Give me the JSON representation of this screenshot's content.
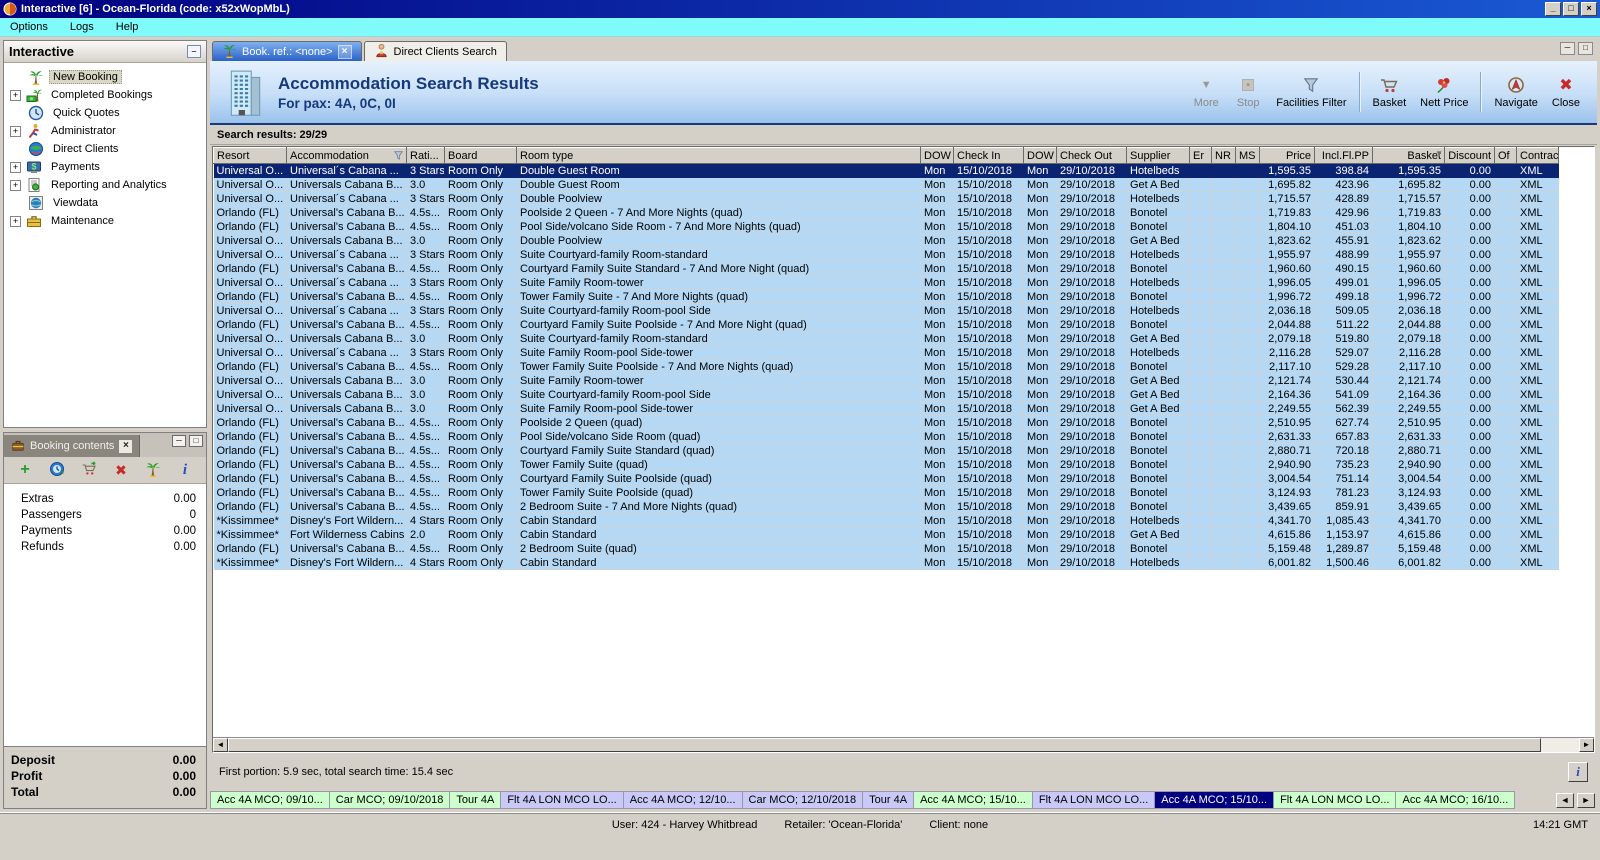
{
  "window": {
    "title": "Interactive [6] - Ocean-Florida (code: x52xWopMbL)",
    "controls": [
      "minimize",
      "maximize",
      "close"
    ]
  },
  "menu": {
    "items": [
      "Options",
      "Logs",
      "Help"
    ]
  },
  "sidebar": {
    "title": "Interactive",
    "items": [
      {
        "label": "New Booking",
        "icon": "palm-tree-icon",
        "expandable": false,
        "selected": true
      },
      {
        "label": "Completed Bookings",
        "icon": "money-palm-icon",
        "expandable": true,
        "selected": false
      },
      {
        "label": "Quick Quotes",
        "icon": "clock-icon",
        "expandable": false,
        "selected": false
      },
      {
        "label": "Administrator",
        "icon": "runner-icon",
        "expandable": true,
        "selected": false
      },
      {
        "label": "Direct Clients",
        "icon": "globe-icon",
        "expandable": false,
        "selected": false
      },
      {
        "label": "Payments",
        "icon": "payments-icon",
        "expandable": true,
        "selected": false
      },
      {
        "label": "Reporting and Analytics",
        "icon": "report-icon",
        "expandable": true,
        "selected": false
      },
      {
        "label": "Viewdata",
        "icon": "viewdata-icon",
        "expandable": false,
        "selected": false
      },
      {
        "label": "Maintenance",
        "icon": "toolbox-icon",
        "expandable": true,
        "selected": false
      }
    ]
  },
  "tabs": [
    {
      "label": "Book. ref.: <none>",
      "icon": "palm-tree-icon",
      "active": true,
      "closable": true
    },
    {
      "label": "Direct Clients Search",
      "icon": "person-icon",
      "active": false,
      "closable": false
    }
  ],
  "header": {
    "title": "Accommodation Search Results",
    "subtitle": "For pax: 4A, 0C, 0I",
    "icon": "building-icon"
  },
  "toolbar": {
    "buttons": [
      {
        "label": "More",
        "icon": "down-arrow-icon",
        "disabled": true,
        "sep_before": false
      },
      {
        "label": "Stop",
        "icon": "stop-icon",
        "disabled": true,
        "sep_before": false
      },
      {
        "label": "Facilities Filter",
        "icon": "funnel-icon",
        "disabled": false,
        "sep_before": false
      },
      {
        "label": "Basket",
        "icon": "basket-icon",
        "disabled": false,
        "sep_before": true
      },
      {
        "label": "Nett Price",
        "icon": "nett-price-icon",
        "disabled": false,
        "sep_before": false
      },
      {
        "label": "Navigate",
        "icon": "compass-icon",
        "disabled": false,
        "sep_before": true
      },
      {
        "label": "Close",
        "icon": "close-icon",
        "disabled": false,
        "sep_before": false
      }
    ]
  },
  "results": {
    "summary": "Search results: 29/29",
    "status": "First portion: 5.9 sec, total search time: 15.4 sec",
    "selected_row_index": 0,
    "columns": [
      {
        "label": "Resort",
        "align": "left",
        "filter_icon": false,
        "sort_icon": false
      },
      {
        "label": "Accommodation",
        "align": "left",
        "filter_icon": true,
        "sort_icon": false
      },
      {
        "label": "Rati...",
        "align": "left",
        "filter_icon": false,
        "sort_icon": false
      },
      {
        "label": "Board",
        "align": "left",
        "filter_icon": false,
        "sort_icon": false
      },
      {
        "label": "Room type",
        "align": "left",
        "filter_icon": false,
        "sort_icon": false
      },
      {
        "label": "DOW",
        "align": "left",
        "filter_icon": false,
        "sort_icon": false
      },
      {
        "label": "Check In",
        "align": "left",
        "filter_icon": false,
        "sort_icon": false
      },
      {
        "label": "DOW",
        "align": "left",
        "filter_icon": false,
        "sort_icon": false
      },
      {
        "label": "Check Out",
        "align": "left",
        "filter_icon": false,
        "sort_icon": false
      },
      {
        "label": "Supplier",
        "align": "left",
        "filter_icon": false,
        "sort_icon": false
      },
      {
        "label": "Er",
        "align": "left",
        "filter_icon": false,
        "sort_icon": false
      },
      {
        "label": "NR",
        "align": "left",
        "filter_icon": false,
        "sort_icon": false
      },
      {
        "label": "MS",
        "align": "left",
        "filter_icon": false,
        "sort_icon": false
      },
      {
        "label": "Price",
        "align": "right",
        "filter_icon": false,
        "sort_icon": false
      },
      {
        "label": "Incl.Fl.PP",
        "align": "right",
        "filter_icon": false,
        "sort_icon": false
      },
      {
        "label": "Basket",
        "align": "right",
        "filter_icon": false,
        "sort_icon": true
      },
      {
        "label": "Discount",
        "align": "right",
        "filter_icon": false,
        "sort_icon": false
      },
      {
        "label": "Of",
        "align": "left",
        "filter_icon": false,
        "sort_icon": false
      },
      {
        "label": "Contract",
        "align": "left",
        "filter_icon": false,
        "sort_icon": false
      }
    ],
    "rows": [
      [
        "Universal O...",
        "Universal´s Cabana ...",
        "3 Stars",
        "Room Only",
        "Double Guest Room",
        "Mon",
        "15/10/2018",
        "Mon",
        "29/10/2018",
        "Hotelbeds",
        "",
        "",
        "",
        "1,595.35",
        "398.84",
        "1,595.35",
        "0.00",
        "",
        "XML"
      ],
      [
        "Universal O...",
        "Universals Cabana B...",
        "3.0",
        "Room Only",
        "Double Guest Room",
        "Mon",
        "15/10/2018",
        "Mon",
        "29/10/2018",
        "Get A Bed",
        "",
        "",
        "",
        "1,695.82",
        "423.96",
        "1,695.82",
        "0.00",
        "",
        "XML"
      ],
      [
        "Universal O...",
        "Universal´s Cabana ...",
        "3 Stars",
        "Room Only",
        "Double Poolview",
        "Mon",
        "15/10/2018",
        "Mon",
        "29/10/2018",
        "Hotelbeds",
        "",
        "",
        "",
        "1,715.57",
        "428.89",
        "1,715.57",
        "0.00",
        "",
        "XML"
      ],
      [
        "Orlando (FL)",
        "Universal's Cabana B...",
        "4.5s...",
        "Room Only",
        "Poolside 2 Queen - 7 And More Nights (quad)",
        "Mon",
        "15/10/2018",
        "Mon",
        "29/10/2018",
        "Bonotel",
        "",
        "",
        "",
        "1,719.83",
        "429.96",
        "1,719.83",
        "0.00",
        "",
        "XML"
      ],
      [
        "Orlando (FL)",
        "Universal's Cabana B...",
        "4.5s...",
        "Room Only",
        "Pool Side/volcano Side Room - 7 And More Nights (quad)",
        "Mon",
        "15/10/2018",
        "Mon",
        "29/10/2018",
        "Bonotel",
        "",
        "",
        "",
        "1,804.10",
        "451.03",
        "1,804.10",
        "0.00",
        "",
        "XML"
      ],
      [
        "Universal O...",
        "Universals Cabana B...",
        "3.0",
        "Room Only",
        "Double Poolview",
        "Mon",
        "15/10/2018",
        "Mon",
        "29/10/2018",
        "Get A Bed",
        "",
        "",
        "",
        "1,823.62",
        "455.91",
        "1,823.62",
        "0.00",
        "",
        "XML"
      ],
      [
        "Universal O...",
        "Universal´s Cabana ...",
        "3 Stars",
        "Room Only",
        "Suite Courtyard-family Room-standard",
        "Mon",
        "15/10/2018",
        "Mon",
        "29/10/2018",
        "Hotelbeds",
        "",
        "",
        "",
        "1,955.97",
        "488.99",
        "1,955.97",
        "0.00",
        "",
        "XML"
      ],
      [
        "Orlando (FL)",
        "Universal's Cabana B...",
        "4.5s...",
        "Room Only",
        "Courtyard Family Suite Standard - 7 And More Night (quad)",
        "Mon",
        "15/10/2018",
        "Mon",
        "29/10/2018",
        "Bonotel",
        "",
        "",
        "",
        "1,960.60",
        "490.15",
        "1,960.60",
        "0.00",
        "",
        "XML"
      ],
      [
        "Universal O...",
        "Universal´s Cabana ...",
        "3 Stars",
        "Room Only",
        "Suite Family Room-tower",
        "Mon",
        "15/10/2018",
        "Mon",
        "29/10/2018",
        "Hotelbeds",
        "",
        "",
        "",
        "1,996.05",
        "499.01",
        "1,996.05",
        "0.00",
        "",
        "XML"
      ],
      [
        "Orlando (FL)",
        "Universal's Cabana B...",
        "4.5s...",
        "Room Only",
        "Tower Family Suite - 7 And More Nights (quad)",
        "Mon",
        "15/10/2018",
        "Mon",
        "29/10/2018",
        "Bonotel",
        "",
        "",
        "",
        "1,996.72",
        "499.18",
        "1,996.72",
        "0.00",
        "",
        "XML"
      ],
      [
        "Universal O...",
        "Universal´s Cabana ...",
        "3 Stars",
        "Room Only",
        "Suite Courtyard-family Room-pool Side",
        "Mon",
        "15/10/2018",
        "Mon",
        "29/10/2018",
        "Hotelbeds",
        "",
        "",
        "",
        "2,036.18",
        "509.05",
        "2,036.18",
        "0.00",
        "",
        "XML"
      ],
      [
        "Orlando (FL)",
        "Universal's Cabana B...",
        "4.5s...",
        "Room Only",
        "Courtyard Family Suite Poolside - 7 And More Night (quad)",
        "Mon",
        "15/10/2018",
        "Mon",
        "29/10/2018",
        "Bonotel",
        "",
        "",
        "",
        "2,044.88",
        "511.22",
        "2,044.88",
        "0.00",
        "",
        "XML"
      ],
      [
        "Universal O...",
        "Universals Cabana B...",
        "3.0",
        "Room Only",
        "Suite Courtyard-family Room-standard",
        "Mon",
        "15/10/2018",
        "Mon",
        "29/10/2018",
        "Get A Bed",
        "",
        "",
        "",
        "2,079.18",
        "519.80",
        "2,079.18",
        "0.00",
        "",
        "XML"
      ],
      [
        "Universal O...",
        "Universal´s Cabana ...",
        "3 Stars",
        "Room Only",
        "Suite Family Room-pool Side-tower",
        "Mon",
        "15/10/2018",
        "Mon",
        "29/10/2018",
        "Hotelbeds",
        "",
        "",
        "",
        "2,116.28",
        "529.07",
        "2,116.28",
        "0.00",
        "",
        "XML"
      ],
      [
        "Orlando (FL)",
        "Universal's Cabana B...",
        "4.5s...",
        "Room Only",
        "Tower Family Suite Poolside - 7 And More Nights (quad)",
        "Mon",
        "15/10/2018",
        "Mon",
        "29/10/2018",
        "Bonotel",
        "",
        "",
        "",
        "2,117.10",
        "529.28",
        "2,117.10",
        "0.00",
        "",
        "XML"
      ],
      [
        "Universal O...",
        "Universals Cabana B...",
        "3.0",
        "Room Only",
        "Suite Family Room-tower",
        "Mon",
        "15/10/2018",
        "Mon",
        "29/10/2018",
        "Get A Bed",
        "",
        "",
        "",
        "2,121.74",
        "530.44",
        "2,121.74",
        "0.00",
        "",
        "XML"
      ],
      [
        "Universal O...",
        "Universals Cabana B...",
        "3.0",
        "Room Only",
        "Suite Courtyard-family Room-pool Side",
        "Mon",
        "15/10/2018",
        "Mon",
        "29/10/2018",
        "Get A Bed",
        "",
        "",
        "",
        "2,164.36",
        "541.09",
        "2,164.36",
        "0.00",
        "",
        "XML"
      ],
      [
        "Universal O...",
        "Universals Cabana B...",
        "3.0",
        "Room Only",
        "Suite Family Room-pool Side-tower",
        "Mon",
        "15/10/2018",
        "Mon",
        "29/10/2018",
        "Get A Bed",
        "",
        "",
        "",
        "2,249.55",
        "562.39",
        "2,249.55",
        "0.00",
        "",
        "XML"
      ],
      [
        "Orlando (FL)",
        "Universal's Cabana B...",
        "4.5s...",
        "Room Only",
        "Poolside 2 Queen (quad)",
        "Mon",
        "15/10/2018",
        "Mon",
        "29/10/2018",
        "Bonotel",
        "",
        "",
        "",
        "2,510.95",
        "627.74",
        "2,510.95",
        "0.00",
        "",
        "XML"
      ],
      [
        "Orlando (FL)",
        "Universal's Cabana B...",
        "4.5s...",
        "Room Only",
        "Pool Side/volcano Side Room (quad)",
        "Mon",
        "15/10/2018",
        "Mon",
        "29/10/2018",
        "Bonotel",
        "",
        "",
        "",
        "2,631.33",
        "657.83",
        "2,631.33",
        "0.00",
        "",
        "XML"
      ],
      [
        "Orlando (FL)",
        "Universal's Cabana B...",
        "4.5s...",
        "Room Only",
        "Courtyard Family Suite Standard (quad)",
        "Mon",
        "15/10/2018",
        "Mon",
        "29/10/2018",
        "Bonotel",
        "",
        "",
        "",
        "2,880.71",
        "720.18",
        "2,880.71",
        "0.00",
        "",
        "XML"
      ],
      [
        "Orlando (FL)",
        "Universal's Cabana B...",
        "4.5s...",
        "Room Only",
        "Tower Family Suite (quad)",
        "Mon",
        "15/10/2018",
        "Mon",
        "29/10/2018",
        "Bonotel",
        "",
        "",
        "",
        "2,940.90",
        "735.23",
        "2,940.90",
        "0.00",
        "",
        "XML"
      ],
      [
        "Orlando (FL)",
        "Universal's Cabana B...",
        "4.5s...",
        "Room Only",
        "Courtyard Family Suite Poolside (quad)",
        "Mon",
        "15/10/2018",
        "Mon",
        "29/10/2018",
        "Bonotel",
        "",
        "",
        "",
        "3,004.54",
        "751.14",
        "3,004.54",
        "0.00",
        "",
        "XML"
      ],
      [
        "Orlando (FL)",
        "Universal's Cabana B...",
        "4.5s...",
        "Room Only",
        "Tower Family Suite Poolside (quad)",
        "Mon",
        "15/10/2018",
        "Mon",
        "29/10/2018",
        "Bonotel",
        "",
        "",
        "",
        "3,124.93",
        "781.23",
        "3,124.93",
        "0.00",
        "",
        "XML"
      ],
      [
        "Orlando (FL)",
        "Universal's Cabana B...",
        "4.5s...",
        "Room Only",
        "2 Bedroom Suite - 7 And More Nights (quad)",
        "Mon",
        "15/10/2018",
        "Mon",
        "29/10/2018",
        "Bonotel",
        "",
        "",
        "",
        "3,439.65",
        "859.91",
        "3,439.65",
        "0.00",
        "",
        "XML"
      ],
      [
        "*Kissimmee*",
        "Disney's Fort Wildern...",
        "4 Stars",
        "Room Only",
        "Cabin Standard",
        "Mon",
        "15/10/2018",
        "Mon",
        "29/10/2018",
        "Hotelbeds",
        "",
        "",
        "",
        "4,341.70",
        "1,085.43",
        "4,341.70",
        "0.00",
        "",
        "XML"
      ],
      [
        "*Kissimmee*",
        "Fort Wilderness Cabins",
        "2.0",
        "Room Only",
        "Cabin Standard",
        "Mon",
        "15/10/2018",
        "Mon",
        "29/10/2018",
        "Get A Bed",
        "",
        "",
        "",
        "4,615.86",
        "1,153.97",
        "4,615.86",
        "0.00",
        "",
        "XML"
      ],
      [
        "Orlando (FL)",
        "Universal's Cabana B...",
        "4.5s...",
        "Room Only",
        "2 Bedroom Suite (quad)",
        "Mon",
        "15/10/2018",
        "Mon",
        "29/10/2018",
        "Bonotel",
        "",
        "",
        "",
        "5,159.48",
        "1,289.87",
        "5,159.48",
        "0.00",
        "",
        "XML"
      ],
      [
        "*Kissimmee*",
        "Disney's Fort Wildern...",
        "4 Stars",
        "Room Only",
        "Cabin Standard",
        "Mon",
        "15/10/2018",
        "Mon",
        "29/10/2018",
        "Hotelbeds",
        "",
        "",
        "",
        "6,001.82",
        "1,500.46",
        "6,001.82",
        "0.00",
        "",
        "XML"
      ]
    ]
  },
  "booking_contents": {
    "title": "Booking contents",
    "toolbar_icons": [
      "plus-icon",
      "availability-clock-icon",
      "basket-add-icon",
      "delete-icon",
      "palm-tree-icon",
      "info-icon"
    ],
    "items": [
      {
        "label": "Extras",
        "value": "0.00"
      },
      {
        "label": "Passengers",
        "value": "0"
      },
      {
        "label": "Payments",
        "value": "0.00"
      },
      {
        "label": "Refunds",
        "value": "0.00"
      }
    ],
    "totals": [
      {
        "label": "Deposit",
        "value": "0.00"
      },
      {
        "label": "Profit",
        "value": "0.00"
      },
      {
        "label": "Total",
        "value": "0.00"
      }
    ]
  },
  "bottom_tabs": [
    {
      "label": "Acc 4A MCO; 09/10...",
      "color": "green",
      "selected": false
    },
    {
      "label": "Car MCO; 09/10/2018",
      "color": "green",
      "selected": false
    },
    {
      "label": "Tour 4A",
      "color": "green",
      "selected": false
    },
    {
      "label": "Flt 4A LON MCO LO...",
      "color": "lavender",
      "selected": false
    },
    {
      "label": "Acc 4A MCO; 12/10...",
      "color": "lavender",
      "selected": false
    },
    {
      "label": "Car MCO; 12/10/2018",
      "color": "lavender",
      "selected": false
    },
    {
      "label": "Tour 4A",
      "color": "lavender",
      "selected": false
    },
    {
      "label": "Acc 4A MCO; 15/10...",
      "color": "green",
      "selected": false
    },
    {
      "label": "Flt 4A LON MCO LO...",
      "color": "lavender",
      "selected": false
    },
    {
      "label": "Acc 4A MCO; 15/10...",
      "color": "navy",
      "selected": true
    },
    {
      "label": "Flt 4A LON MCO LO...",
      "color": "green",
      "selected": false
    },
    {
      "label": "Acc 4A MCO; 16/10...",
      "color": "green",
      "selected": false
    }
  ],
  "status_bar": {
    "user": "User: 424 - Harvey Whitbread",
    "retailer": "Retailer: 'Ocean-Florida'",
    "client": "Client: none",
    "time": "14:21 GMT"
  },
  "colors": {
    "titlebar_left": "#000080",
    "titlebar_right": "#1a5ad4",
    "menubar": "#80fbfb",
    "row_bg": "#b5d9f5",
    "selected_row_bg": "#0a2472",
    "header_title": "#16387c",
    "tab_green": "#ccffcc",
    "tab_lavender": "#c9c9f8",
    "tab_selected": "#000080"
  }
}
